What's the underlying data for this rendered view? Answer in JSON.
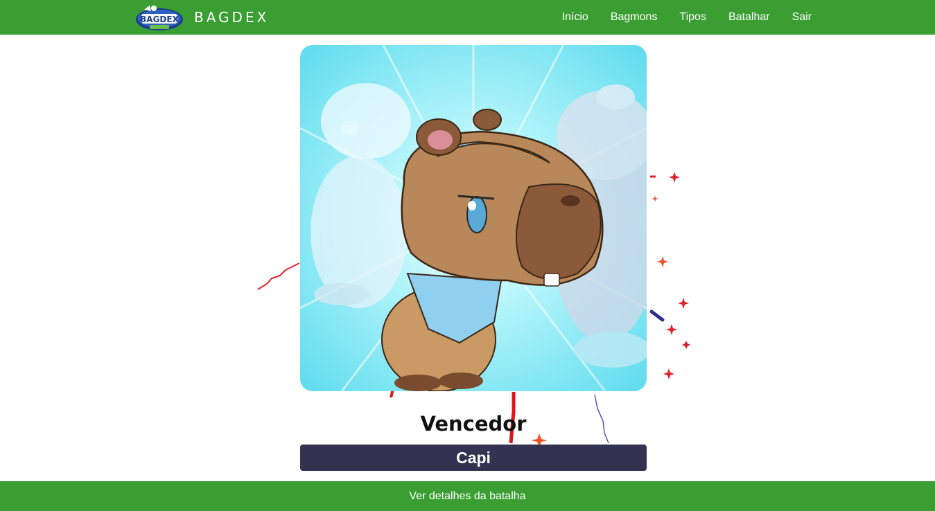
{
  "brand": {
    "name": "BAGDEX",
    "logo_icon": "bagdex-logo-icon"
  },
  "nav": {
    "items": [
      {
        "label": "Início"
      },
      {
        "label": "Bagmons"
      },
      {
        "label": "Tipos"
      },
      {
        "label": "Batalhar"
      },
      {
        "label": "Sair"
      }
    ]
  },
  "result": {
    "heading": "Vencedor",
    "winner_name": "Capi",
    "winner_image_icon": "capybara-bagmon-illustration"
  },
  "footer": {
    "details_label": "Ver detalhes da batalha"
  },
  "colors": {
    "primary_green": "#3a9e33",
    "name_bar": "#333250",
    "image_bg": "#7fe6f4"
  }
}
